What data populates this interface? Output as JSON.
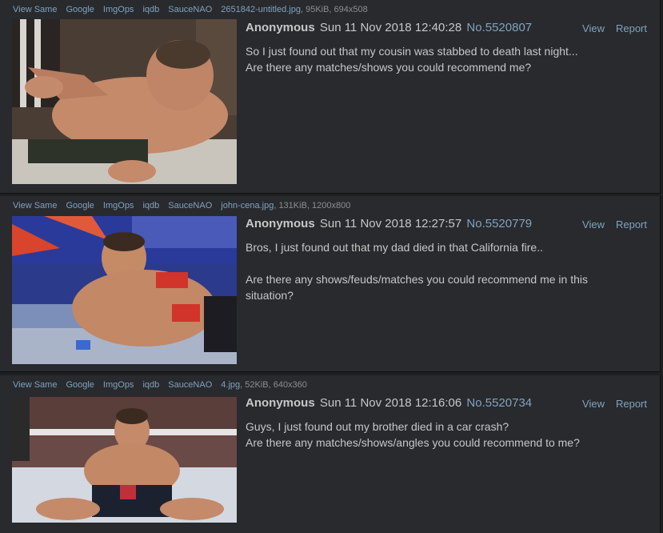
{
  "common": {
    "links": [
      "View Same",
      "Google",
      "ImgOps",
      "iqdb",
      "SauceNAO"
    ],
    "view_label": "View",
    "report_label": "Report",
    "name": "Anonymous"
  },
  "posts": [
    {
      "filename": "2651842-untitled.jpg",
      "filemeta": ", 95KiB, 694x508",
      "date": "Sun 11 Nov 2018 12:40:28",
      "number": "No.5520807",
      "lines": [
        "So I just found out that my cousin was stabbed to death last night...",
        "Are there any matches/shows you could recommend me?"
      ]
    },
    {
      "filename": "john-cena.jpg",
      "filemeta": ", 131KiB, 1200x800",
      "date": "Sun 11 Nov 2018 12:27:57",
      "number": "No.5520779",
      "lines": [
        "Bros, I just found out that my dad died in that California fire..",
        "",
        "Are there any shows/feuds/matches you could recommend me in this",
        "situation?"
      ]
    },
    {
      "filename": "4.jpg",
      "filemeta": ", 52KiB, 640x360",
      "date": "Sun 11 Nov 2018 12:16:06",
      "number": "No.5520734",
      "lines": [
        "Guys, I just found out my brother died in a car crash?",
        "Are there any matches/shows/angles you could recommend to me?"
      ]
    }
  ]
}
